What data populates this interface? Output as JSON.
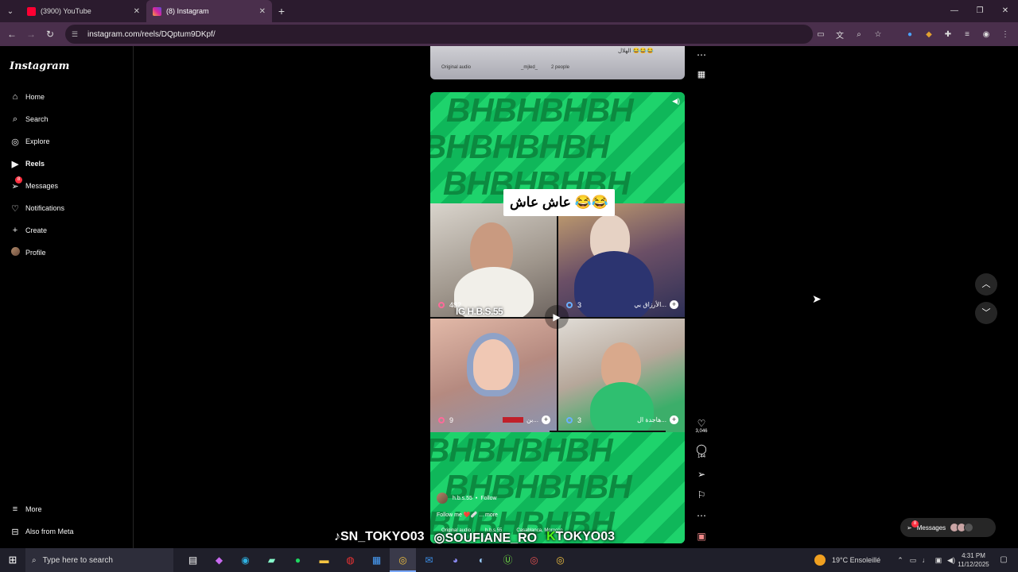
{
  "browser": {
    "tabs": [
      {
        "title": "(3900) YouTube",
        "active": false
      },
      {
        "title": "(8) Instagram",
        "active": true
      }
    ],
    "url": "instagram.com/reels/DQptum9DKpf/"
  },
  "sidebar": {
    "logo": "Instagram",
    "items": [
      {
        "label": "Home",
        "icon": "home-icon"
      },
      {
        "label": "Search",
        "icon": "search-icon"
      },
      {
        "label": "Explore",
        "icon": "compass-icon"
      },
      {
        "label": "Reels",
        "icon": "reels-icon"
      },
      {
        "label": "Messages",
        "icon": "send-icon",
        "badge": "8"
      },
      {
        "label": "Notifications",
        "icon": "heart-icon"
      },
      {
        "label": "Create",
        "icon": "plus-icon"
      },
      {
        "label": "Profile",
        "icon": "avatar"
      }
    ],
    "more": "More",
    "also_from_meta": "Also from Meta"
  },
  "prev_reel": {
    "audio": "Original audio",
    "user": "_mjled_",
    "people": "2 people",
    "caption": "الهلال 😂😂😂"
  },
  "reel": {
    "banner": "BHBHBHBH",
    "caption": "عاش عاش 😂😂",
    "cells": [
      {
        "count": "482",
        "name": "",
        "label": "IG H.B.S.55"
      },
      {
        "count": "3",
        "name": "الأرزاق بي..."
      },
      {
        "count": "9",
        "name": "بن..."
      },
      {
        "count": "3",
        "name": "هاجدة ال..."
      }
    ],
    "author": "h.b.s.55",
    "follow": "Follow",
    "caption_text": "Follow me ❤️🩹 ... more",
    "audio": "Original audio",
    "audio_user": "h.b.s.55",
    "location": "Casablanca, Morocco"
  },
  "actions": {
    "likes": "3,046",
    "comments": "144"
  },
  "messages_pill": {
    "label": "Messages",
    "badge": "8"
  },
  "watermark": [
    "SN_TOKYO03",
    "SOUFIANE_RO",
    "TOKYO03"
  ],
  "taskbar": {
    "search_placeholder": "Type here to search",
    "weather": "19°C  Ensoleillé",
    "time": "4:31 PM",
    "date": "11/12/2025"
  }
}
